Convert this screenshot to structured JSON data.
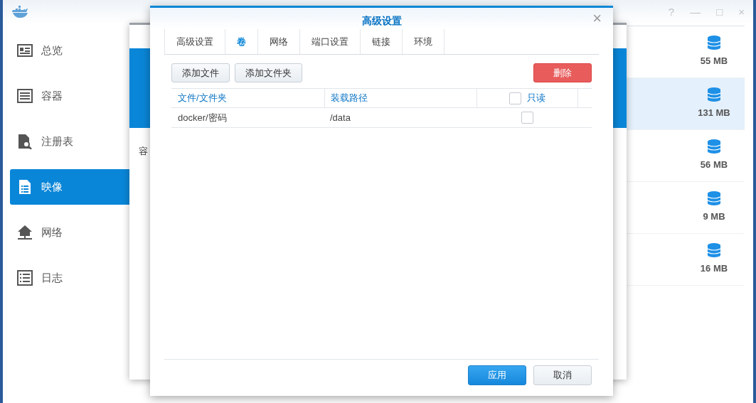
{
  "window_controls": [
    "?",
    "—",
    "□",
    "×"
  ],
  "sidebar": {
    "items": [
      {
        "label": "总览",
        "selected": false
      },
      {
        "label": "容器",
        "selected": false
      },
      {
        "label": "注册表",
        "selected": false
      },
      {
        "label": "映像",
        "selected": true
      },
      {
        "label": "网络",
        "selected": false
      },
      {
        "label": "日志",
        "selected": false
      }
    ]
  },
  "image_list": {
    "rows": [
      {
        "size": "55 MB",
        "selected": false
      },
      {
        "size": "131 MB",
        "selected": true
      },
      {
        "size": "56 MB",
        "selected": false
      },
      {
        "size": "9 MB",
        "selected": false
      },
      {
        "size": "16 MB",
        "selected": false
      }
    ]
  },
  "back_window": {
    "label": "容"
  },
  "dialog": {
    "title": "高级设置",
    "close": "×",
    "tabs": [
      {
        "label": "高级设置",
        "selected": false
      },
      {
        "label": "卷",
        "selected": true
      },
      {
        "label": "网络",
        "selected": false
      },
      {
        "label": "端口设置",
        "selected": false
      },
      {
        "label": "链接",
        "selected": false
      },
      {
        "label": "环境",
        "selected": false
      }
    ],
    "toolbar": {
      "add_file": "添加文件",
      "add_folder": "添加文件夹",
      "delete": "删除"
    },
    "table": {
      "columns": [
        "文件/文件夹",
        "装载路径",
        "只读"
      ],
      "readonly_all": false,
      "rows": [
        {
          "path": "docker/密码",
          "mount": "/data",
          "readonly": false
        }
      ]
    },
    "buttons": {
      "apply": "应用",
      "cancel": "取消"
    }
  }
}
